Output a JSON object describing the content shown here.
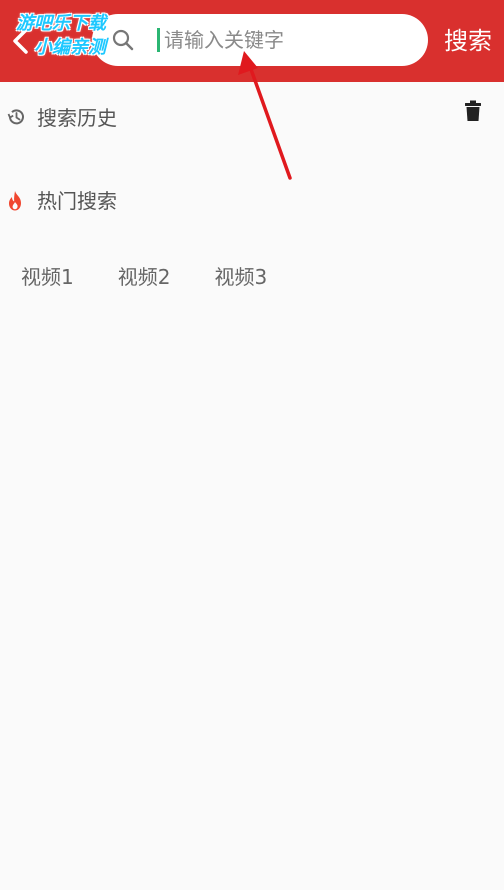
{
  "header": {
    "back_icon": "chevron-left-icon",
    "search_icon": "search-icon",
    "search": {
      "value": "",
      "placeholder": "请输入关键字"
    },
    "search_button_label": "搜索",
    "bar_color": "#d9302e"
  },
  "watermark": {
    "line1": "游吧乐下载",
    "line2": "小编亲测"
  },
  "history": {
    "icon": "history-icon",
    "title": "搜索历史",
    "delete_icon": "trash-icon"
  },
  "hot": {
    "icon": "fire-icon",
    "title": "热门搜索",
    "tags": [
      "视频1",
      "视频2",
      "视频3"
    ]
  },
  "annotation": {
    "type": "arrow",
    "color": "#e0191e"
  }
}
